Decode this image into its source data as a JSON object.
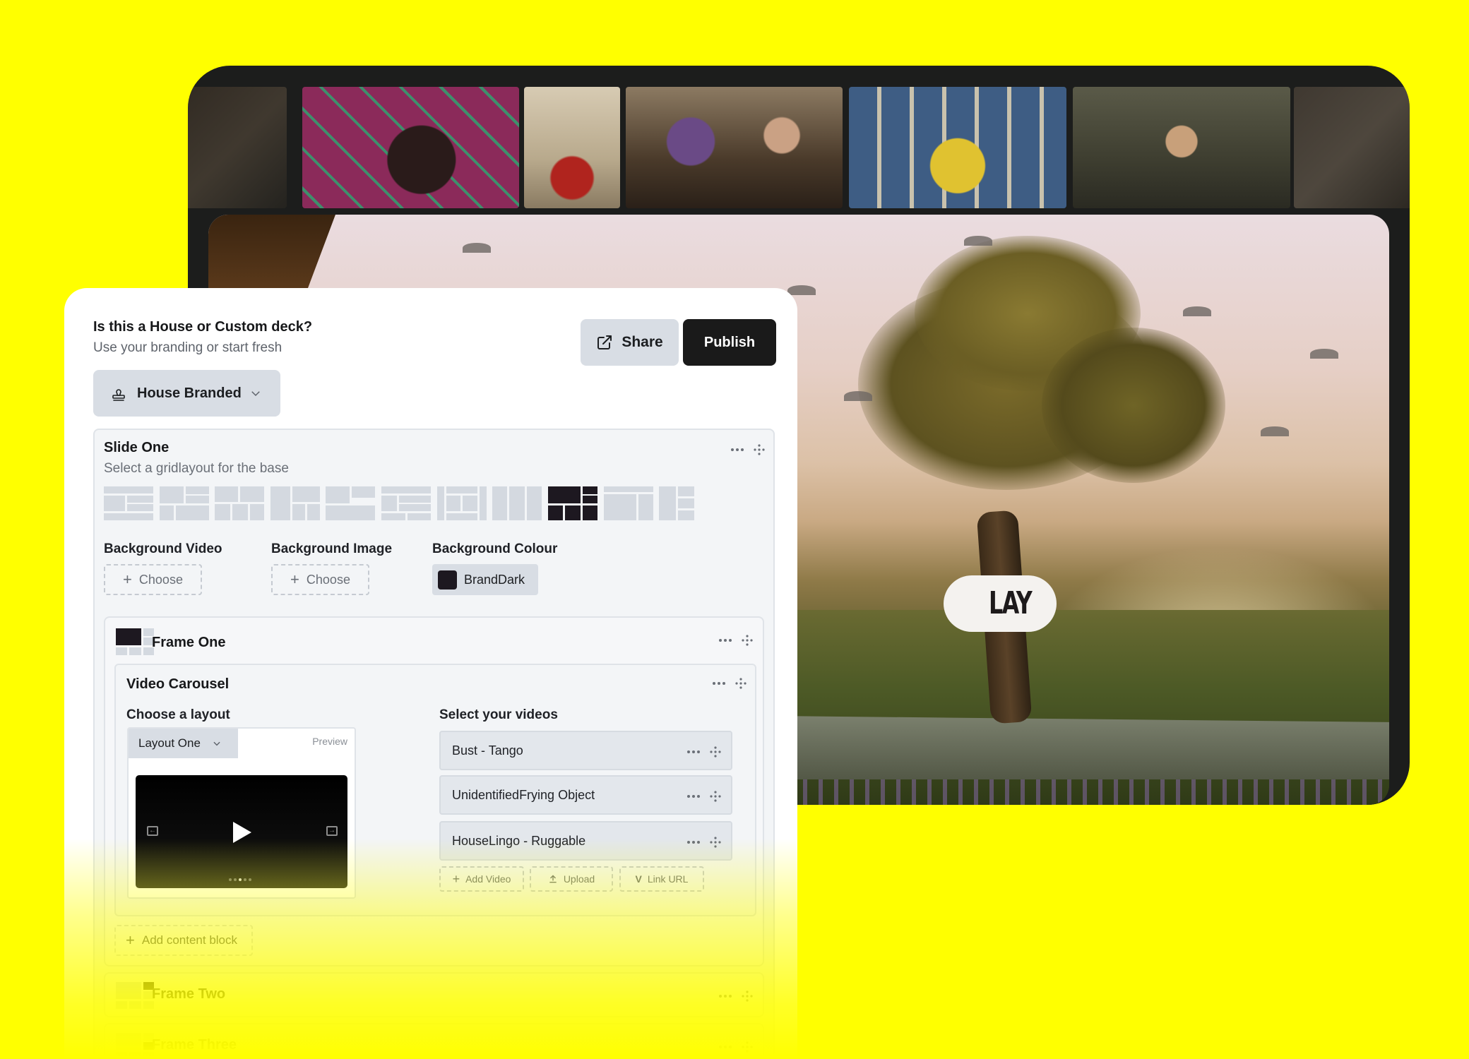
{
  "colors": {
    "page_background": "#ffff00",
    "device_frame": "#1c1d1c",
    "brand_dark": "#1d1820",
    "button_secondary": "#d8dde4",
    "button_primary": "#1a1a1a"
  },
  "preview": {
    "hero_overlay_text": "LAY"
  },
  "deck_type": {
    "question": "Is this a House or Custom deck?",
    "subtitle": "Use your branding or start fresh",
    "selected": "House Branded",
    "icon": "stamp-icon"
  },
  "actions": {
    "share_label": "Share",
    "share_icon": "external-link-icon",
    "publish_label": "Publish"
  },
  "slide": {
    "title": "Slide One",
    "subtitle": "Select a gridlayout for the base",
    "selected_layout_index": 8,
    "background_video_label": "Background Video",
    "background_image_label": "Background Image",
    "background_colour_label": "Background Colour",
    "choose_label": "Choose",
    "background_colour_value": "BrandDark"
  },
  "frame_one": {
    "title": "Frame One",
    "block": {
      "title": "Video Carousel",
      "layout_heading": "Choose a layout",
      "layout_value": "Layout One",
      "preview_label": "Preview",
      "videos_heading": "Select your videos",
      "videos": [
        {
          "name": "Bust - Tango"
        },
        {
          "name": "UnidentifiedFrying Object"
        },
        {
          "name": "HouseLingo - Ruggable"
        }
      ],
      "add_video_label": "Add Video",
      "upload_label": "Upload",
      "link_url_label": "Link URL"
    },
    "add_content_label": "Add content block"
  },
  "frames": [
    {
      "title": "Frame Two"
    },
    {
      "title": "Frame Three"
    }
  ]
}
